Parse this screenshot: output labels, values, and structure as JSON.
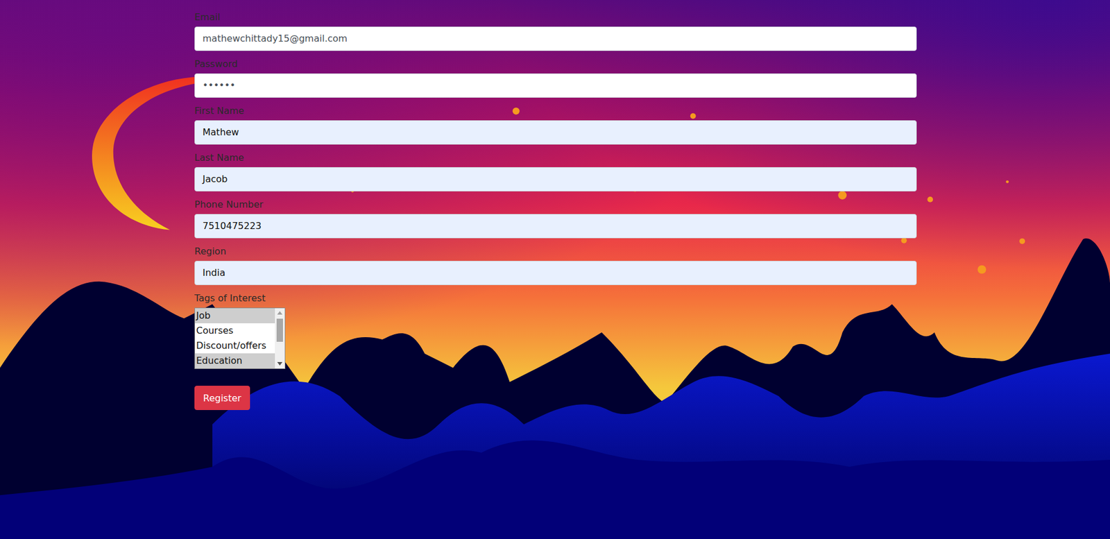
{
  "form": {
    "fields": [
      {
        "label": "Email",
        "value": "mathewchittady15@gmail.com",
        "autofilled": false
      },
      {
        "label": "Password",
        "value": "••••••",
        "autofilled": false
      },
      {
        "label": "First Name",
        "value": "Mathew",
        "autofilled": true
      },
      {
        "label": "Last Name",
        "value": "Jacob",
        "autofilled": true
      },
      {
        "label": "Phone Number",
        "value": "7510475223",
        "autofilled": true
      },
      {
        "label": "Region",
        "value": "India",
        "autofilled": true
      }
    ],
    "tags": {
      "label": "Tags of Interest",
      "options": [
        {
          "label": "Job",
          "selected": true
        },
        {
          "label": "Courses",
          "selected": false
        },
        {
          "label": "Discount/offers",
          "selected": false
        },
        {
          "label": "Education",
          "selected": true
        }
      ]
    },
    "buttons": [
      "Register"
    ]
  }
}
